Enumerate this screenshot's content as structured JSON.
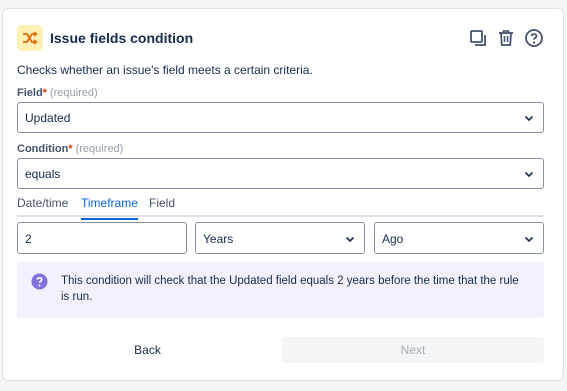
{
  "panel": {
    "title": "Issue fields condition",
    "description": "Checks whether an issue's field meets a certain criteria.",
    "header_icon": "shuffle-icon",
    "actions": [
      "duplicate-icon",
      "trash-icon",
      "help-icon"
    ]
  },
  "field": {
    "label": "Field",
    "required_mark": "*",
    "hint": "(required)",
    "value": "Updated"
  },
  "condition": {
    "label": "Condition",
    "required_mark": "*",
    "hint": "(required)",
    "value": "equals"
  },
  "tabs": [
    {
      "label": "Date/time",
      "active": false
    },
    {
      "label": "Timeframe",
      "active": true
    },
    {
      "label": "Field",
      "active": false
    }
  ],
  "timeframe": {
    "amount": "2",
    "unit": "Years",
    "direction": "Ago"
  },
  "info": {
    "text": "This condition will check that the Updated field equals 2 years before the time that the rule is run."
  },
  "footer": {
    "back_label": "Back",
    "next_label": "Next"
  },
  "colors": {
    "accent": "#0c66e4",
    "info_bg": "#f3f0ff",
    "info_icon": "#8270db",
    "header_icon_bg": "#fff0b3",
    "header_icon_fg": "#e56910"
  }
}
